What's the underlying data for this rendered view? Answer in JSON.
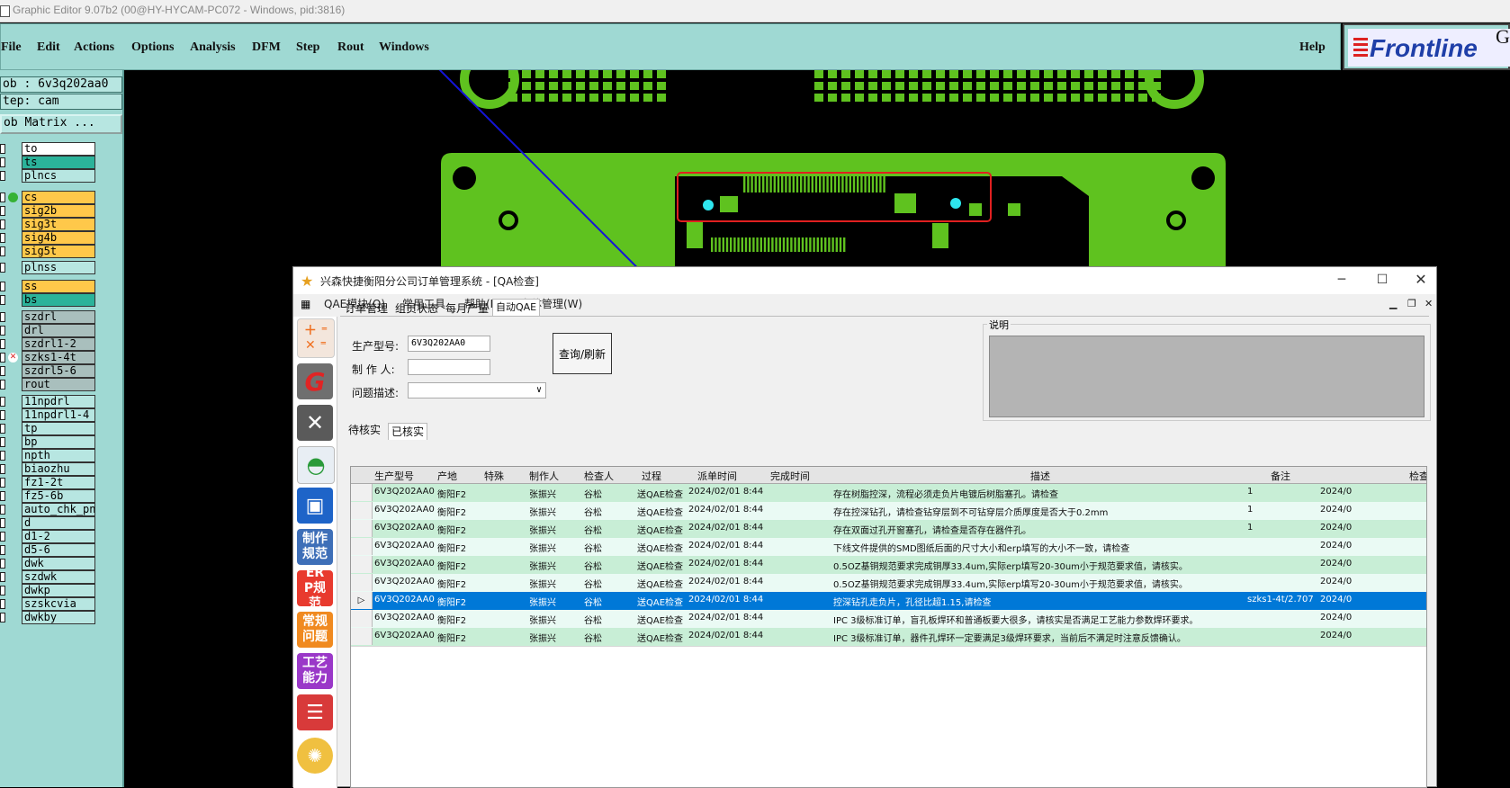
{
  "window": {
    "title": "Graphic Editor 9.07b2 (00@HY-HYCAM-PC072 - Windows, pid:3816)"
  },
  "menubar": {
    "items": [
      "File",
      "Edit",
      "Actions",
      "Options",
      "Analysis",
      "DFM",
      "Step",
      "Rout",
      "Windows"
    ],
    "help": "Help"
  },
  "logo": {
    "text": "Frontline",
    "suffix": "G"
  },
  "left_panel": {
    "job": "ob : 6v3q202aa0",
    "step": "tep: cam",
    "matrix": "ob Matrix ...",
    "layers": [
      {
        "name": "to",
        "color": "#ffffff"
      },
      {
        "name": "ts",
        "color": "#2bb39a"
      },
      {
        "name": "plncs",
        "color": "#b7e6e1"
      },
      {
        "name": "cs",
        "color": "#ffc84a"
      },
      {
        "name": "sig2b",
        "color": "#ffc84a"
      },
      {
        "name": "sig3t",
        "color": "#ffc84a"
      },
      {
        "name": "sig4b",
        "color": "#ffc84a"
      },
      {
        "name": "sig5t",
        "color": "#ffc84a"
      },
      {
        "name": "plnss",
        "color": "#b7e6e1"
      },
      {
        "name": "ss",
        "color": "#ffc84a"
      },
      {
        "name": "bs",
        "color": "#2bb39a"
      },
      {
        "name": "szdrl",
        "color": "#a9bfbd"
      },
      {
        "name": "drl",
        "color": "#a9bfbd"
      },
      {
        "name": "szdrl1-2",
        "color": "#a9bfbd"
      },
      {
        "name": "szks1-4t",
        "color": "#a9bfbd"
      },
      {
        "name": "szdrl5-6",
        "color": "#a9bfbd"
      },
      {
        "name": "rout",
        "color": "#a9bfbd"
      },
      {
        "name": "11npdrl",
        "color": "#b7e6e1"
      },
      {
        "name": "11npdrl1-4",
        "color": "#b7e6e1"
      },
      {
        "name": "tp",
        "color": "#b7e6e1"
      },
      {
        "name": "bp",
        "color": "#b7e6e1"
      },
      {
        "name": "npth",
        "color": "#b7e6e1"
      },
      {
        "name": "biaozhu",
        "color": "#b7e6e1"
      },
      {
        "name": "fz1-2t",
        "color": "#b7e6e1"
      },
      {
        "name": "fz5-6b",
        "color": "#b7e6e1"
      },
      {
        "name": "auto_chk_pn",
        "color": "#b7e6e1"
      },
      {
        "name": "d",
        "color": "#b7e6e1"
      },
      {
        "name": "d1-2",
        "color": "#b7e6e1"
      },
      {
        "name": "d5-6",
        "color": "#b7e6e1"
      },
      {
        "name": "dwk",
        "color": "#b7e6e1"
      },
      {
        "name": "szdwk",
        "color": "#b7e6e1"
      },
      {
        "name": "dwkp",
        "color": "#b7e6e1"
      },
      {
        "name": "szskcvia",
        "color": "#b7e6e1"
      },
      {
        "name": "dwkby",
        "color": "#b7e6e1"
      }
    ]
  },
  "app": {
    "title": "兴森快捷衡阳分公司订单管理系统 - [QA检查]",
    "menu": [
      "QAE模块(Q)",
      "常用工具",
      "帮助(H)",
      "窗体管理(W)"
    ],
    "tabs": [
      "订单管理",
      "组员状态",
      "每月产量",
      "自动QAE"
    ],
    "form": {
      "model_label": "生产型号:",
      "model_value": "6V3Q202AA0",
      "maker_label": "制 作 人:",
      "maker_value": "",
      "issue_label": "问题描述:",
      "query_button": "查询/刷新",
      "note_label": "说明"
    },
    "subtabs": [
      "待核实",
      "已核实"
    ],
    "toolbar_labels": [
      "制作规范",
      "ERP规范",
      "常规问题",
      "工艺能力"
    ],
    "grid": {
      "headers": [
        "生产型号",
        "产地",
        "特殊",
        "制作人",
        "检查人",
        "过程",
        "派单时间",
        "完成时间",
        "描述",
        "备注",
        "检查"
      ],
      "rows": [
        [
          "6V3Q202AA0",
          "衡阳F2",
          "",
          "张振兴",
          "谷松",
          "送QAE检查",
          "2024/02/01 8:44",
          "",
          "存在树脂控深，流程必须走负片电镀后树脂塞孔。请检查",
          "1",
          "2024/0"
        ],
        [
          "6V3Q202AA0",
          "衡阳F2",
          "",
          "张振兴",
          "谷松",
          "送QAE检查",
          "2024/02/01 8:44",
          "",
          "存在控深钻孔，请检查钻穿层到不可钻穿层介质厚度是否大于0.2mm",
          "1",
          "2024/0"
        ],
        [
          "6V3Q202AA0",
          "衡阳F2",
          "",
          "张振兴",
          "谷松",
          "送QAE检查",
          "2024/02/01 8:44",
          "",
          "存在双面过孔开窗塞孔，请检查是否存在器件孔。",
          "1",
          "2024/0"
        ],
        [
          "6V3Q202AA0",
          "衡阳F2",
          "",
          "张振兴",
          "谷松",
          "送QAE检查",
          "2024/02/01 8:44",
          "",
          "下线文件提供的SMD图纸后面的尺寸大小和erp填写的大小不一致，请检查",
          "",
          "2024/0"
        ],
        [
          "6V3Q202AA0",
          "衡阳F2",
          "",
          "张振兴",
          "谷松",
          "送QAE检查",
          "2024/02/01 8:44",
          "",
          "0.5OZ基铜规范要求完成铜厚33.4um,实际erp填写20-30um小于规范要求值，请核实。",
          "",
          "2024/0"
        ],
        [
          "6V3Q202AA0",
          "衡阳F2",
          "",
          "张振兴",
          "谷松",
          "送QAE检查",
          "2024/02/01 8:44",
          "",
          "0.5OZ基铜规范要求完成铜厚33.4um,实际erp填写20-30um小于规范要求值，请核实。",
          "",
          "2024/0"
        ],
        [
          "6V3Q202AA0",
          "衡阳F2",
          "",
          "张振兴",
          "谷松",
          "送QAE检查",
          "2024/02/01 8:44",
          "",
          "控深钻孔走负片，孔径比超1.15,请检查",
          "szks1-4t/2.707",
          "2024/0"
        ],
        [
          "6V3Q202AA0",
          "衡阳F2",
          "",
          "张振兴",
          "谷松",
          "送QAE检查",
          "2024/02/01 8:44",
          "",
          "IPC 3级标准订单，盲孔板焊环和普通板要大很多，请核实是否满足工艺能力参数焊环要求。",
          "",
          "2024/0"
        ],
        [
          "6V3Q202AA0",
          "衡阳F2",
          "",
          "张振兴",
          "谷松",
          "送QAE检查",
          "2024/02/01 8:44",
          "",
          "IPC 3级标准订单，器件孔焊环一定要满足3级焊环要求，当前后不满足时注意反馈确认。",
          "",
          "2024/0"
        ]
      ],
      "selected_row": 6
    }
  },
  "colors": {
    "pcb_green": "#5fc21f",
    "selection_blue": "#0078d7",
    "row_green": "#c8eed6",
    "row_light": "#eafaf4"
  }
}
